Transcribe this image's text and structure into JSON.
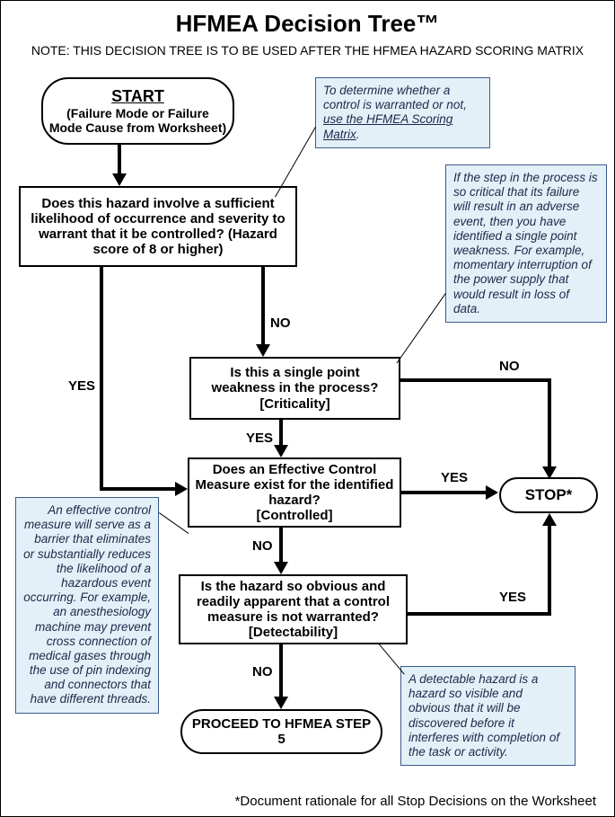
{
  "title": "HFMEA Decision Tree™",
  "subtitle": "NOTE: THIS DECISION TREE IS TO BE USED AFTER THE HFMEA HAZARD SCORING MATRIX",
  "footer": "*Document rationale for all Stop Decisions on the Worksheet",
  "nodes": {
    "start": {
      "head": "START",
      "sub": "(Failure Mode or Failure Mode Cause from Worksheet)"
    },
    "q1": "Does this hazard involve a sufficient likelihood of occurrence and severity to warrant that it be controlled? (Hazard score of 8 or higher)",
    "q2_a": "Is this a single point weakness in the process?",
    "q2_b": "[Criticality]",
    "q3_a": "Does an Effective Control Measure exist for the identified hazard?",
    "q3_b": "[Controlled]",
    "q4_a": "Is the hazard so obvious and readily apparent that a control measure is not warranted?",
    "q4_b": "[Detectability]",
    "stop": "STOP*",
    "proceed": "PROCEED TO HFMEA STEP 5"
  },
  "labels": {
    "yes": "YES",
    "no": "NO"
  },
  "notes": {
    "n1_a": "To determine whether a control is warranted or not, ",
    "n1_b": "use the HFMEA Scoring Matrix",
    "n1_c": ".",
    "n2": "If the step in the process is so critical that its failure will result in an adverse event, then you have identified a single point weakness. For example, momentary interruption of the power supply that would result in loss of data.",
    "n3": "An effective control measure will serve as a barrier that eliminates or substantially reduces the likelihood of a hazardous event occurring. For example, an anesthesiology machine may prevent cross connection of medical gases through the use of pin indexing and connectors that have different threads.",
    "n4": "A detectable hazard is a hazard so visible and obvious that it will be discovered before it interferes with completion of the task or activity."
  }
}
